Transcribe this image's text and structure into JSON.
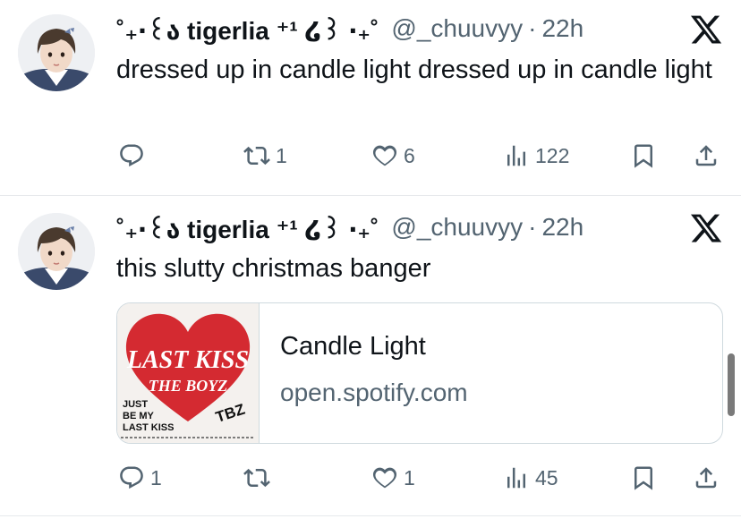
{
  "tweets": [
    {
      "display_name": "˚₊‧꒰ა tigerlia ⁺¹ ໒꒱ ‧₊˚",
      "handle": "@_chuuvyy",
      "separator": "·",
      "time": "22h",
      "text": "dressed up in candle light dressed up in candle light",
      "counts": {
        "reply": "",
        "retweet": "1",
        "like": "6",
        "views": "122"
      }
    },
    {
      "display_name": "˚₊‧꒰ა tigerlia ⁺¹ ໒꒱ ‧₊˚",
      "handle": "@_chuuvyy",
      "separator": "·",
      "time": "22h",
      "text": "this slutty christmas banger",
      "card": {
        "title": "Candle Light",
        "domain": "open.spotify.com",
        "cover": {
          "line1": "LAST KISS",
          "line2": "THE BOYZ",
          "line3": "JUST",
          "line4": "BE MY",
          "line5": "LAST KISS",
          "badge": "TBZ",
          "accent": "#d42a31"
        }
      },
      "counts": {
        "reply": "1",
        "retweet": "",
        "like": "1",
        "views": "45"
      }
    }
  ],
  "icons": {
    "reply": "reply-icon",
    "retweet": "retweet-icon",
    "like": "heart-icon",
    "views": "views-icon",
    "bookmark": "bookmark-icon",
    "share": "share-icon",
    "brand": "x-logo-icon"
  },
  "colors": {
    "text": "#0f1419",
    "secondary": "#536471",
    "border": "#cfd9de"
  }
}
